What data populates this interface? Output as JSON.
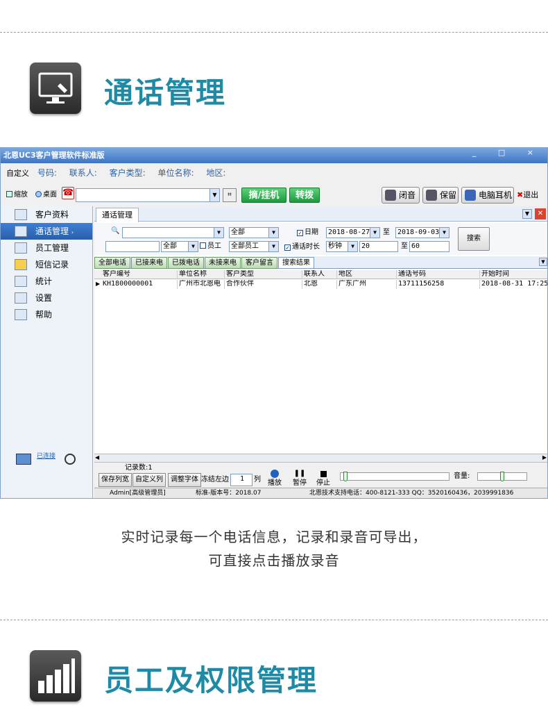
{
  "sections": [
    {
      "title": "通话管理",
      "icon": "monitor-touch-icon"
    },
    {
      "title": "员工及权限管理",
      "icon": "bar-chart-icon"
    }
  ],
  "caption": {
    "line1": "实时记录每一个电话信息，记录和录音可导出，",
    "line2": "可直接点击播放录音"
  },
  "app": {
    "title": "北恩UC3客户管理软件标准版",
    "window_buttons": "_ □ ×",
    "infobar": {
      "custom": "自定义",
      "phone": "号码:",
      "contact": "联系人:",
      "type": "客户类型:",
      "company": "单位名称:",
      "region": "地区:"
    },
    "toolbar": {
      "minimize": "缩放",
      "desktop": "桌面",
      "pickup": "摘/挂机",
      "transfer": "转拨",
      "mute": "闭音",
      "hold": "保留",
      "headset": "电脑耳机",
      "exit": "退出"
    },
    "sidebar": [
      "客户资料",
      "通话管理",
      "员工管理",
      "短信记录",
      "统计",
      "设置",
      "帮助"
    ],
    "tab": "通话管理",
    "filter": {
      "all1": "全部",
      "date_label": "日期",
      "date_from": "2018-08-27",
      "to1": "至",
      "date_to": "2018-09-03",
      "all2": "全部",
      "employee": "员工",
      "all_employees": "全部员工",
      "duration_label": "通话时长",
      "unit": "秒钟",
      "dur_from": "20",
      "to2": "至",
      "dur_to": "60",
      "search": "搜索"
    },
    "subtabs": [
      "全部电话",
      "已接来电",
      "已拨电话",
      "未接来电",
      "客户留言",
      "搜索结果"
    ],
    "table": {
      "headers": [
        "客户编号",
        "单位名称",
        "客户类型",
        "联系人",
        "地区",
        "通话号码",
        "开始时间"
      ],
      "rows": [
        [
          "KH1800000001",
          "广州市北恩电",
          "合作伙伴",
          "北恩",
          "广东广州",
          "13711156258",
          "2018-08-31 17:25:"
        ]
      ]
    },
    "footer": {
      "record_count": "记录数:1",
      "save_cols": "保存列宽",
      "custom_cols": "自定义列",
      "font": "调整字体",
      "freeze": "冻结左边",
      "freeze_value": "1",
      "col": "列",
      "play": "播放",
      "pause": "暂停",
      "stop": "停止",
      "volume": "音量:"
    },
    "connected": "已连接",
    "status": {
      "user": "Admin[高级管理员]",
      "version": "标准-版本号：2018.07",
      "support": "北恩技术支持电话：400-8121-333  QQ：3520160436，2039991836"
    }
  }
}
